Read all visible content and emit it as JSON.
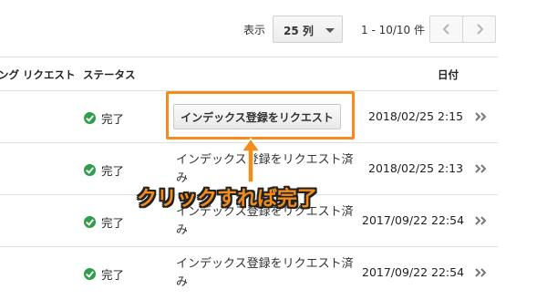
{
  "toolbar": {
    "display_label": "表示",
    "rows_select_value": "25 列",
    "range_text": "1 - 10/10 件"
  },
  "table": {
    "headers": {
      "request": "ング リクエスト",
      "status": "ステータス",
      "date": "日付"
    },
    "rows": [
      {
        "status": "完了",
        "request_button": "インデックス登録をリクエスト",
        "date": "2018/02/25 2:15"
      },
      {
        "status": "完了",
        "request_done": "インデックス登録をリクエスト済み",
        "date": "2018/02/25 2:13"
      },
      {
        "status": "完了",
        "request_done": "インデックス登録をリクエスト済み",
        "date": "2017/09/22 22:54"
      },
      {
        "status": "完了",
        "request_done": "インデックス登録をリクエスト済み",
        "date": "2017/09/22 22:54"
      }
    ]
  },
  "annotation": {
    "callout_text": "クリックすれば完了",
    "color": "#f28c1a"
  },
  "colors": {
    "status_ok": "#2e9e4a",
    "divider": "#e0e0e0"
  }
}
